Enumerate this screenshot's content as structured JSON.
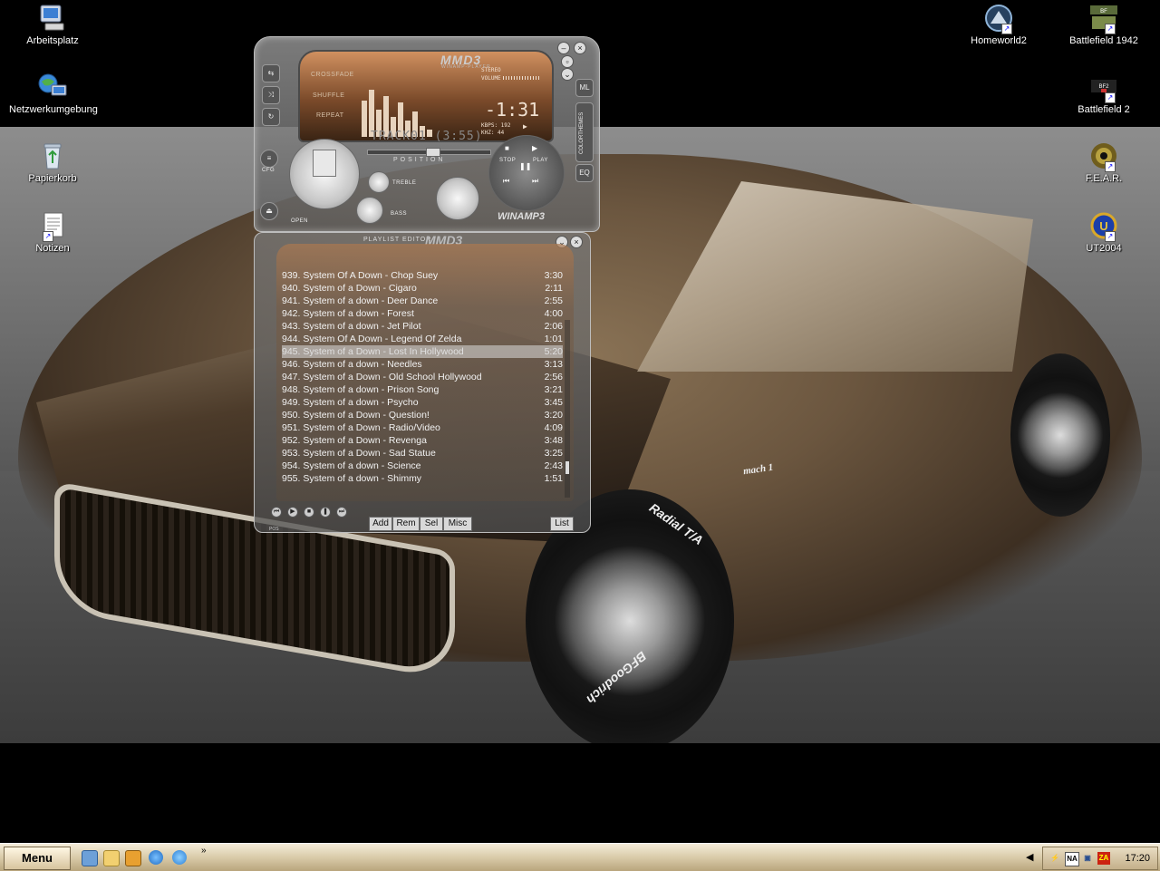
{
  "desktop": {
    "icons_left": [
      {
        "label": "Arbeitsplatz",
        "icon": "my-computer-icon"
      },
      {
        "label": "Netzwerkumgebung",
        "icon": "network-icon"
      },
      {
        "label": "Papierkorb",
        "icon": "recycle-bin-icon"
      },
      {
        "label": "Notizen",
        "icon": "notes-icon"
      }
    ],
    "icons_right": [
      {
        "label": "Homeworld2",
        "icon": "homeworld2-icon"
      },
      {
        "label": "Battlefield 1942",
        "icon": "battlefield-1942-icon"
      },
      {
        "label": "Battlefield 2",
        "icon": "battlefield-2-icon"
      },
      {
        "label": "F.E.A.R.",
        "icon": "fear-icon"
      },
      {
        "label": "UT2004",
        "icon": "ut2004-icon"
      }
    ],
    "wallpaper": {
      "badge": "mach 1",
      "tyre_text": "Radial T/A",
      "tyre_brand": "BFGoodrich"
    }
  },
  "player": {
    "logo": "MMD3",
    "logo_sub": "WINAMP-PLAYER",
    "labels": {
      "crossfade": "CROSSFADE",
      "shuffle": "SHUFFLE",
      "repeat": "REPEAT"
    },
    "stereo": "STEREO",
    "volume_label": "VOLUME",
    "time": "-1:31",
    "kbps": "KBPS: 192",
    "khz": "KHZ: 44",
    "track": "TRACK01 (3:55)",
    "position_label": "POSITION",
    "treble": "TREBLE",
    "bass": "BASS",
    "cfg": "CFG",
    "open": "OPEN",
    "stop": "STOP",
    "play": "PLAY",
    "brand": "WINAMP3",
    "side_colorthemes": "COLORTHEMES",
    "side_ml": "ML",
    "side_eq": "EQ"
  },
  "playlist": {
    "title": "PLAYLIST EDITOR",
    "brand": "MMD3",
    "items": [
      {
        "title": "939. System Of A Down - Chop Suey",
        "duration": "3:30"
      },
      {
        "title": "940. System of a Down - Cigaro",
        "duration": "2:11"
      },
      {
        "title": "941. System of a down - Deer Dance",
        "duration": "2:55"
      },
      {
        "title": "942. System of a down - Forest",
        "duration": "4:00"
      },
      {
        "title": "943. System of a down - Jet Pilot",
        "duration": "2:06"
      },
      {
        "title": "944. System Of A Down - Legend Of Zelda",
        "duration": "1:01"
      },
      {
        "title": "945. System of a Down - Lost In Hollywood",
        "duration": "5:20"
      },
      {
        "title": "946. System of a down - Needles",
        "duration": "3:13"
      },
      {
        "title": "947. System of a Down - Old School Hollywood",
        "duration": "2:56"
      },
      {
        "title": "948. System of a down - Prison Song",
        "duration": "3:21"
      },
      {
        "title": "949. System of a down - Psycho",
        "duration": "3:45"
      },
      {
        "title": "950. System of a Down - Question!",
        "duration": "3:20"
      },
      {
        "title": "951. System of a Down - Radio/Video",
        "duration": "4:09"
      },
      {
        "title": "952. System of a Down - Revenga",
        "duration": "3:48"
      },
      {
        "title": "953. System of a Down - Sad Statue",
        "duration": "3:25"
      },
      {
        "title": "954. System of a down - Science",
        "duration": "2:43"
      },
      {
        "title": "955. System of a down - Shimmy",
        "duration": "1:51"
      }
    ],
    "selected_index": 6,
    "buttons": {
      "add": "Add",
      "rem": "Rem",
      "sel": "Sel",
      "misc": "Misc",
      "list": "List"
    },
    "pos_label": "POS"
  },
  "taskbar": {
    "start_label": "Menu",
    "quick_launch": [
      "show-desktop-icon",
      "explorer-icon",
      "winamp-icon",
      "browser-icon",
      "internet-explorer-icon"
    ],
    "more": "»",
    "tray": [
      "tray-lightning-icon",
      "tray-na-icon",
      "tray-network-icon",
      "tray-zonealarm-icon"
    ],
    "tray_text": {
      "na": "NA",
      "za": "ZA"
    },
    "clock": "17:20"
  }
}
